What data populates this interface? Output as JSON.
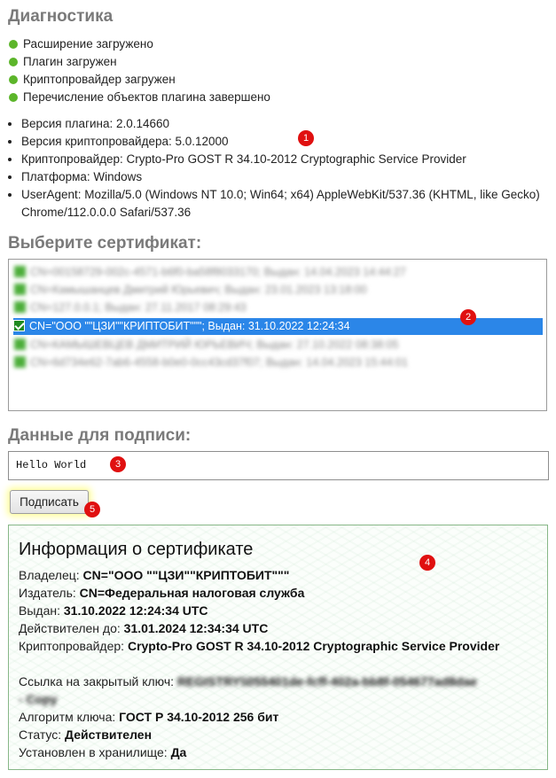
{
  "diagnostics": {
    "heading": "Диагностика",
    "status_items": [
      "Расширение загружено",
      "Плагин загружен",
      "Криптопровайдер загружен",
      "Перечисление объектов плагина завершено"
    ],
    "status_color": "#5cb52a",
    "info_items": [
      "Версия плагина: 2.0.14660",
      "Версия криптопровайдера: 5.0.12000",
      "Криптопровайдер: Crypto-Pro GOST R 34.10-2012 Cryptographic Service Provider",
      "Платформа: Windows",
      "UserAgent: Mozilla/5.0 (Windows NT 10.0; Win64; x64) AppleWebKit/537.36 (KHTML, like Gecko) Chrome/112.0.0.0 Safari/537.36"
    ]
  },
  "certificates": {
    "heading": "Выберите сертификат:",
    "items": [
      "CN=00158729-002c-4571-b6f0-ba58f8033170; Выдан: 14.04.2023 14:44:27",
      "CN=Камышанцев Дмитрий Юрьевич; Выдан: 23.01.2023 13:18:00",
      "CN=127.0.0.1; Выдан: 27.11.2017 08:29:43",
      "CN=\"ООО \"\"ЦЗИ\"\"КРИПТОБИТ\"\"\"; Выдан: 31.10.2022 12:24:34",
      "CN=КАМЫШЕВЦЕВ ДМИТРИЙ ЮРЬЕВИЧ; Выдан: 27.10.2022 08:38:05",
      "CN=6d734e62-7ab6-4558-b0e0-0cc43cd37f07; Выдан: 14.04.2023 15:44:01"
    ],
    "selected_index": 3
  },
  "sign_data": {
    "heading": "Данные для подписи:",
    "value": "Hello World"
  },
  "sign_button_label": "Подписать",
  "cert_info": {
    "title": "Информация о сертификате",
    "owner_label": "Владелец:",
    "owner_value": "CN=\"ООО \"\"ЦЗИ\"\"КРИПТОБИТ\"\"\"",
    "issuer_label": "Издатель:",
    "issuer_value": "CN=Федеральная налоговая служба",
    "issued_label": "Выдан:",
    "issued_value": "31.10.2022 12:24:34 UTC",
    "valid_label": "Действителен до:",
    "valid_value": "31.01.2024 12:34:34 UTC",
    "provider_label": "Криптопровайдер:",
    "provider_value": "Crypto-Pro GOST R 34.10-2012 Cryptographic Service Provider",
    "key_link_label": "Ссылка на закрытый ключ:",
    "key_link_value": "REGISTRY\\\\055401de-fcff-402a-bb8f-054677ad8dae - Copy",
    "algorithm_label": "Алгоритм ключа:",
    "algorithm_value": "ГОСТ Р 34.10-2012 256 бит",
    "status_label": "Статус:",
    "status_value": "Действителен",
    "installed_label": "Установлен в хранилище:",
    "installed_value": "Да"
  },
  "annotation_badges": [
    "1",
    "2",
    "3",
    "4",
    "5"
  ],
  "colors": {
    "selection": "#2b86e8",
    "badge": "#e01010",
    "card_border": "#87b787"
  }
}
